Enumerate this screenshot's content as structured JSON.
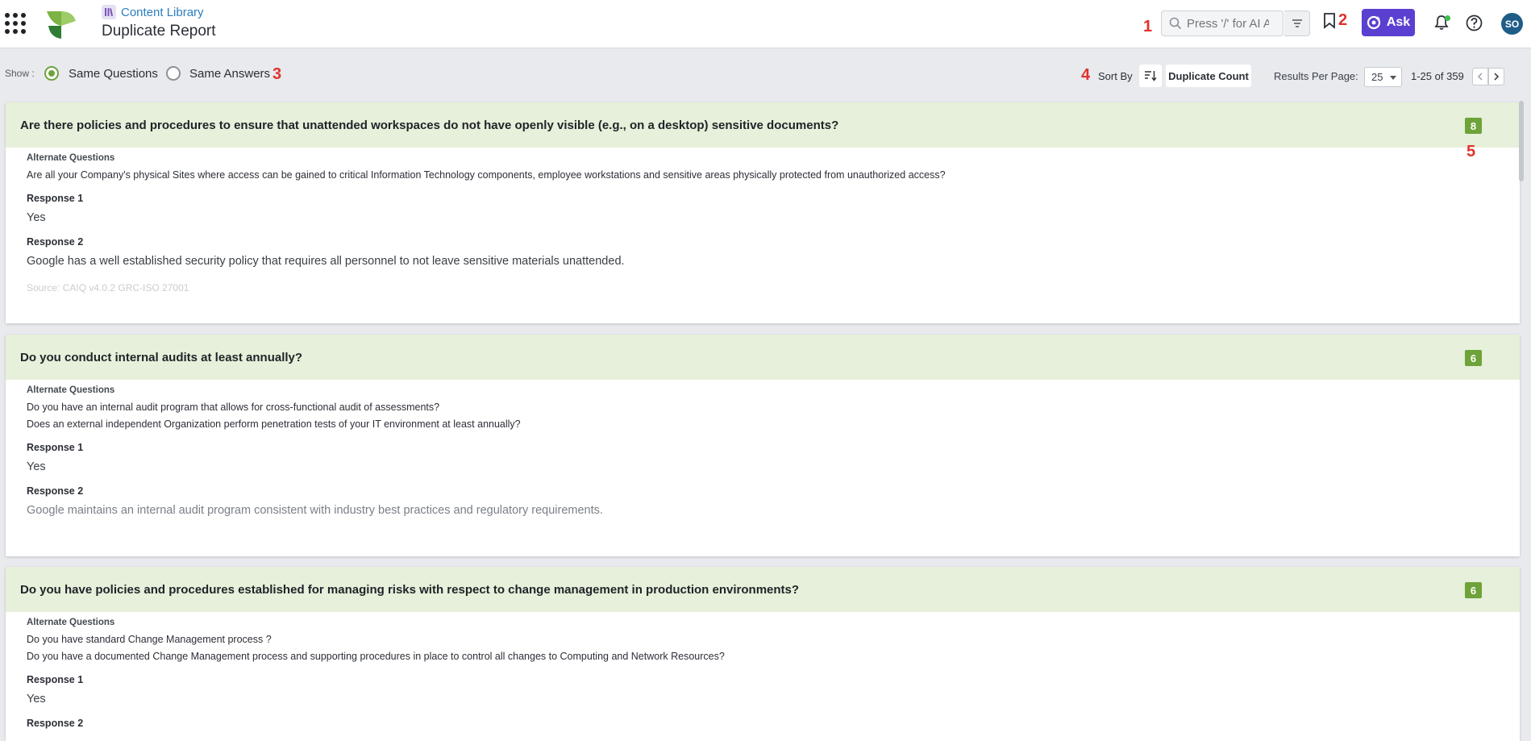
{
  "header": {
    "breadcrumb": "Content Library",
    "title": "Duplicate Report",
    "search_placeholder": "Press '/' for AI Ass",
    "ask_label": "Ask",
    "avatar_initials": "SO"
  },
  "markers": [
    "1",
    "2",
    "3",
    "4",
    "5"
  ],
  "toolbar": {
    "show_label": "Show :",
    "options": [
      "Same Questions",
      "Same Answers"
    ],
    "selected": "Same Questions",
    "sort_label": "Sort By",
    "sort_field": "Duplicate Count",
    "results_per_page_label": "Results Per Page:",
    "results_per_page": "25",
    "range": "1-25 of 359"
  },
  "cards": [
    {
      "question": "Are there policies and procedures to ensure that unattended workspaces do not have openly visible (e.g., on a desktop) sensitive documents?",
      "count": "8",
      "alt_label": "Alternate Questions",
      "alternates": [
        "Are all your Company's physical Sites where access can be gained to critical Information Technology components, employee workstations and sensitive areas physically protected from unauthorized access?"
      ],
      "responses": [
        {
          "label": "Response 1",
          "value": "Yes"
        },
        {
          "label": "Response 2",
          "value": "Google has a well established security policy that requires all personnel to not leave sensitive materials unattended."
        }
      ],
      "more": "Source: CAIQ v4.0.2 GRC-ISO 27001"
    },
    {
      "question": "Do you conduct internal audits at least annually?",
      "count": "6",
      "alt_label": "Alternate Questions",
      "alternates": [
        "Do you have an internal audit program that allows for cross-functional audit of assessments?",
        "Does an external independent Organization perform penetration tests of your IT environment at least annually?"
      ],
      "responses": [
        {
          "label": "Response 1",
          "value": "Yes"
        },
        {
          "label": "Response 2",
          "value": "Google maintains an internal audit program consistent with industry best practices and regulatory requirements."
        }
      ]
    },
    {
      "question": "Do you have policies and procedures established for managing risks with respect to change management in production environments?",
      "count": "6",
      "alt_label": "Alternate Questions",
      "alternates": [
        "Do you have standard Change Management process ?",
        "Do you have a documented Change Management process and supporting procedures in place to control all changes to Computing and Network Resources?"
      ],
      "responses": [
        {
          "label": "Response 1",
          "value": "Yes"
        },
        {
          "label": "Response 2",
          "value": ""
        }
      ]
    }
  ]
}
